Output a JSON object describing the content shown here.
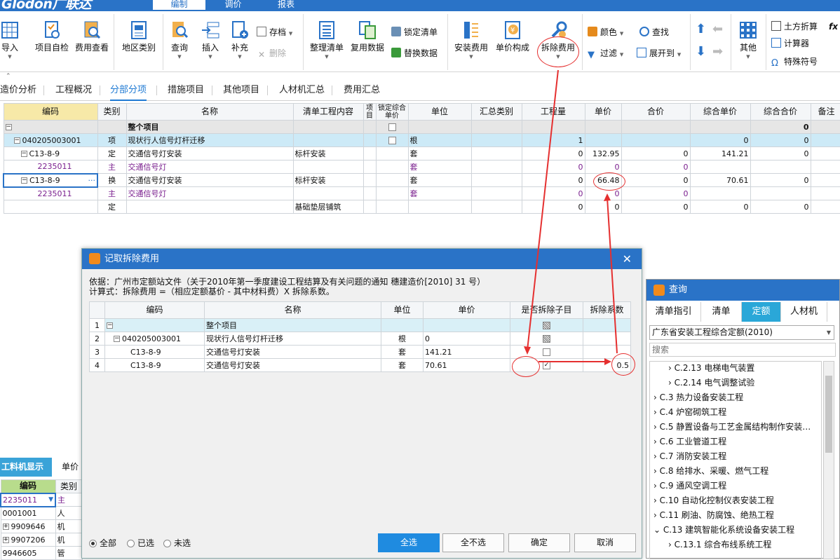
{
  "app": {
    "logo": "Glodon广联达",
    "menu_tabs": [
      "编制",
      "调价",
      "报表"
    ],
    "active_menu": "编制"
  },
  "ribbon": {
    "buttons": [
      {
        "id": "import",
        "label": "导入"
      },
      {
        "id": "self_check",
        "label": "项目自检"
      },
      {
        "id": "fee_view",
        "label": "费用查看"
      },
      {
        "id": "region",
        "label": "地区类别"
      },
      {
        "id": "query",
        "label": "查询"
      },
      {
        "id": "insert",
        "label": "插入"
      },
      {
        "id": "supplement",
        "label": "补充"
      },
      {
        "id": "organize",
        "label": "整理清单"
      },
      {
        "id": "reuse",
        "label": "复用数据"
      },
      {
        "id": "install_fee",
        "label": "安装费用"
      },
      {
        "id": "unit_price_comp",
        "label": "单价构成"
      },
      {
        "id": "demolish_fee",
        "label": "拆除费用"
      },
      {
        "id": "other",
        "label": "其他"
      }
    ],
    "small": {
      "archive": "存档",
      "delete": "删除",
      "lock_list": "锁定清单",
      "replace_data": "替换数据",
      "color": "颜色",
      "find": "查找",
      "filter": "过滤",
      "expand_to": "展开到",
      "earthwork": "土方折算",
      "calculator": "计算器",
      "special_char": "特殊符号",
      "fx": "fx"
    }
  },
  "nav_tabs": [
    "造价分析",
    "工程概况",
    "分部分项",
    "措施项目",
    "其他项目",
    "人材机汇总",
    "费用汇总"
  ],
  "active_nav": "分部分项",
  "main_table": {
    "headers": [
      "编码",
      "类别",
      "名称",
      "清单工程内容",
      "项目",
      "锁定综合单价",
      "单位",
      "汇总类别",
      "工程量",
      "单价",
      "合价",
      "综合单价",
      "综合合价",
      "备注"
    ],
    "rows": [
      {
        "code": "",
        "type": "",
        "name": "整个项目",
        "content": "",
        "unit": "",
        "qty": "",
        "price": "",
        "total": "",
        "comp_price": "",
        "comp_total": "0"
      },
      {
        "code": "040205003001",
        "type": "项",
        "name": "现状行人信号灯杆迁移",
        "content": "",
        "unit": "根",
        "qty": "1",
        "price": "",
        "total": "",
        "comp_price": "0",
        "comp_total": "0"
      },
      {
        "code": "C13-8-9",
        "type": "定",
        "name": "交通信号灯安装",
        "content": "标杆安装",
        "unit": "套",
        "qty": "0",
        "price": "132.95",
        "total": "0",
        "comp_price": "141.21",
        "comp_total": "0"
      },
      {
        "code": "2235011",
        "type": "主",
        "name": "交通信号灯",
        "content": "",
        "unit": "套",
        "qty": "0",
        "price": "0",
        "total": "0",
        "comp_price": "",
        "comp_total": ""
      },
      {
        "code": "C13-8-9",
        "type": "换",
        "name": "交通信号灯安装",
        "content": "标杆安装",
        "unit": "套",
        "qty": "0",
        "price": "66.48",
        "total": "0",
        "comp_price": "70.61",
        "comp_total": "0"
      },
      {
        "code": "2235011",
        "type": "主",
        "name": "交通信号灯",
        "content": "",
        "unit": "套",
        "qty": "0",
        "price": "0",
        "total": "0",
        "comp_price": "",
        "comp_total": ""
      },
      {
        "code": "",
        "type": "定",
        "name": "",
        "content": "基础垫层铺筑",
        "unit": "",
        "qty": "0",
        "price": "0",
        "total": "0",
        "comp_price": "0",
        "comp_total": "0"
      }
    ]
  },
  "bottom_left": {
    "tabs": [
      "工料机显示",
      "单价"
    ],
    "headers": [
      "编码",
      "类别"
    ],
    "rows": [
      {
        "code": "2235011",
        "type": "主"
      },
      {
        "code": "0001001",
        "type": "人"
      },
      {
        "code": "9909646",
        "type": "机"
      },
      {
        "code": "9907206",
        "type": "机"
      },
      {
        "code": "9946605",
        "type": "管"
      }
    ]
  },
  "dialog": {
    "title": "记取拆除费用",
    "basis": "依据：广州市定额站文件（关于2010年第一季度建设工程结算及有关问题的通知 穗建造价[2010] 31 号）",
    "formula": "计算式：拆除费用 =（相应定额基价 - 其中材料费）X 拆除系数。",
    "headers": [
      "编码",
      "名称",
      "单位",
      "单价",
      "是否拆除子目",
      "拆除系数"
    ],
    "rows": [
      {
        "n": "1",
        "code": "",
        "name": "整个项目",
        "unit": "",
        "price": "",
        "coef": ""
      },
      {
        "n": "2",
        "code": "040205003001",
        "name": "现状行人信号灯杆迁移",
        "unit": "根",
        "price": "0",
        "coef": ""
      },
      {
        "n": "3",
        "code": "C13-8-9",
        "name": "交通信号灯安装",
        "unit": "套",
        "price": "141.21",
        "coef": ""
      },
      {
        "n": "4",
        "code": "C13-8-9",
        "name": "交通信号灯安装",
        "unit": "套",
        "price": "70.61",
        "coef": "0.5"
      }
    ],
    "radios": [
      "全部",
      "已选",
      "未选"
    ],
    "buttons": {
      "select_all": "全选",
      "select_none": "全不选",
      "ok": "确定",
      "cancel": "取消"
    }
  },
  "query": {
    "title": "查询",
    "tabs": [
      "清单指引",
      "清单",
      "定额",
      "人材机"
    ],
    "active_tab": "定额",
    "dropdown": "广东省安装工程综合定额(2010)",
    "search_placeholder": "搜索",
    "tree": [
      "C.2.13 电梯电气装置",
      "C.2.14 电气调整试验",
      "C.3 热力设备安装工程",
      "C.4 炉窑砌筑工程",
      "C.5 静置设备与工艺金属结构制作安装…",
      "C.6 工业管道工程",
      "C.7 消防安装工程",
      "C.8 给排水、采暖、燃气工程",
      "C.9 通风空调工程",
      "C.10 自动化控制仪表安装工程",
      "C.11 刷油、防腐蚀、绝热工程",
      "C.13 建筑智能化系统设备安装工程",
      "C.13.1 综合布线系统工程"
    ]
  },
  "colors": {
    "brand": "#2a73c7",
    "accent": "#1f8be0",
    "annotation": "#e53030"
  }
}
